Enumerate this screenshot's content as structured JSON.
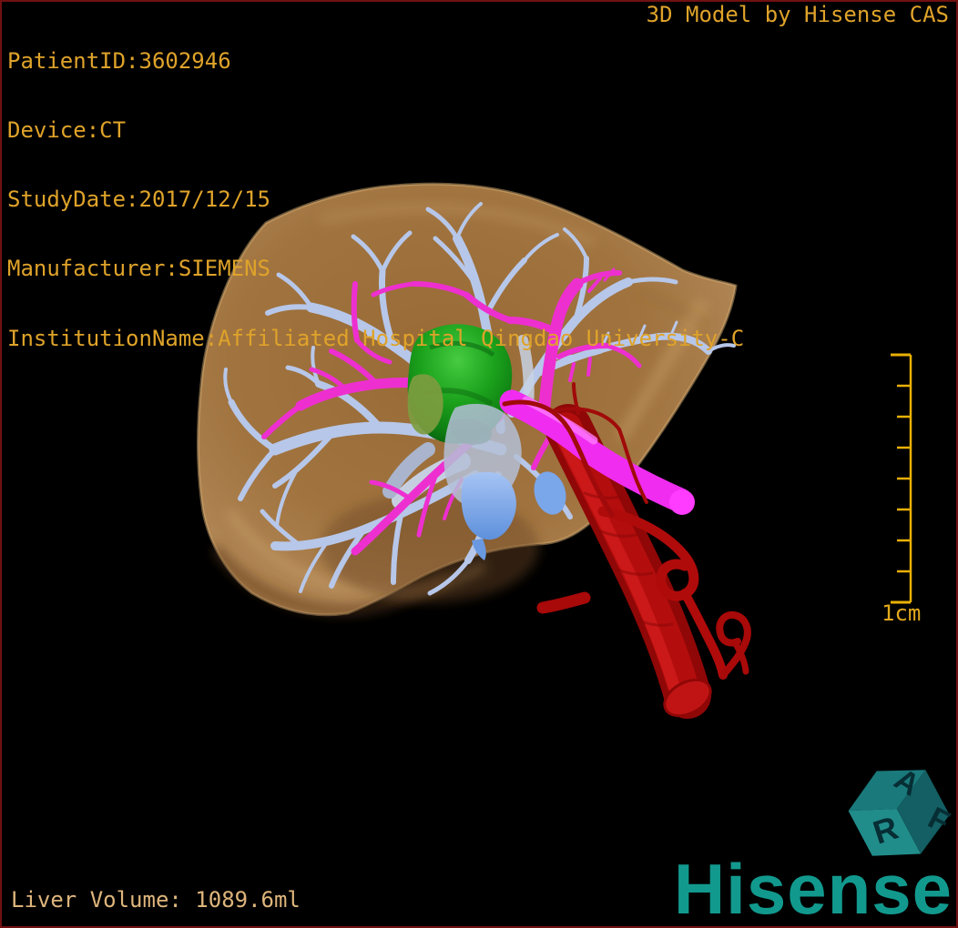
{
  "overlay": {
    "top_left_lines": [
      "PatientID:3602946",
      "Device:CT",
      "StudyDate:2017/12/15",
      "Manufacturer:SIEMENS",
      "InstitutionName:Affiliated Hospital Qingdao University-C"
    ],
    "top_right_caption": "3D Model by Hisense CAS",
    "liver_volume": "Liver Volume: 1089.6ml",
    "scale_label": "1cm",
    "scale_segments": 8
  },
  "branding": {
    "logo_text": "Hisense",
    "cube_letters": [
      "R",
      "A",
      "F"
    ]
  },
  "colors": {
    "overlay_text": "#DFA32A",
    "volume_text": "#DEB57C",
    "scale_bar": "#EAB005",
    "brand_teal": "#12998E",
    "border": "#701012",
    "background": "#000000"
  },
  "model": {
    "structures": [
      {
        "name": "liver",
        "color": "#B07C40"
      },
      {
        "name": "hepatic-veins",
        "color": "#B7C7E9"
      },
      {
        "name": "portal-vein",
        "color": "#F02CF0"
      },
      {
        "name": "hepatic-artery-aorta",
        "color": "#B00B0B"
      },
      {
        "name": "tumor",
        "color": "#1FA01F"
      },
      {
        "name": "biliary-structure",
        "color": "#7AA6EA"
      }
    ]
  }
}
